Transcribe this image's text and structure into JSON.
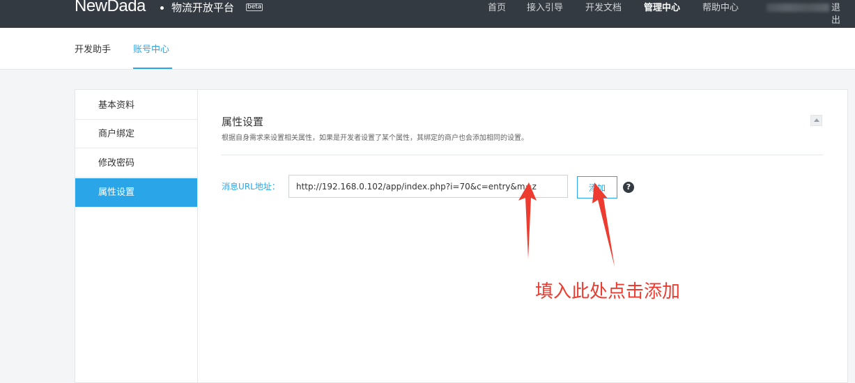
{
  "topbar": {
    "logo": "NewDada",
    "platform_title": "物流开放平台",
    "beta_badge": "beta",
    "nav": [
      {
        "label": "首页",
        "active": false
      },
      {
        "label": "接入引导",
        "active": false
      },
      {
        "label": "开发文档",
        "active": false
      },
      {
        "label": "管理中心",
        "active": true
      },
      {
        "label": "帮助中心",
        "active": false
      }
    ],
    "logout_label": "退出"
  },
  "subnav": {
    "tabs": [
      {
        "label": "开发助手",
        "active": false
      },
      {
        "label": "账号中心",
        "active": true
      }
    ]
  },
  "sidebar": {
    "items": [
      {
        "label": "基本资料",
        "active": false
      },
      {
        "label": "商户绑定",
        "active": false
      },
      {
        "label": "修改密码",
        "active": false
      },
      {
        "label": "属性设置",
        "active": true
      }
    ]
  },
  "main": {
    "section_title": "属性设置",
    "section_description": "根据自身需求来设置相关属性，如果是开发者设置了某个属性，其绑定的商户也会添加相同的设置。",
    "url_field": {
      "label": "消息URL地址：",
      "value": "http://192.168.0.102/app/index.php?i=70&c=entry&m=z"
    },
    "add_button_label": "添加",
    "help_icon_glyph": "?"
  },
  "annotation": {
    "text": "填入此处点击添加",
    "color": "#ee3b2f"
  },
  "colors": {
    "topbar_bg": "#333a41",
    "accent": "#2aa6e8",
    "annotation_red": "#ee3b2f"
  }
}
